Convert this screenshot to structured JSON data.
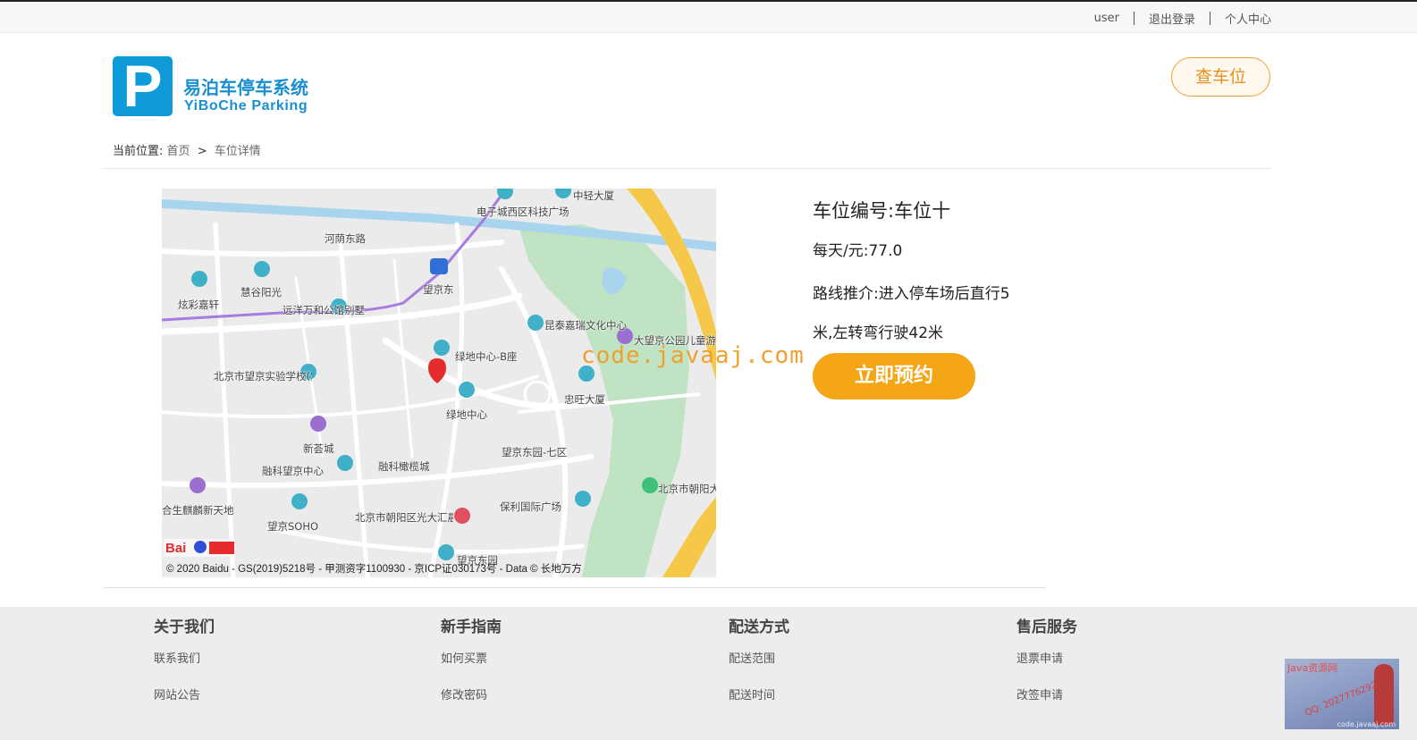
{
  "topbar": {
    "user": "user",
    "logout": "退出登录",
    "profile": "个人中心"
  },
  "logo": {
    "letter": "P",
    "name_cn": "易泊车停车系统",
    "name_en": "YiBoChe Parking"
  },
  "header": {
    "find_button": "查车位"
  },
  "breadcrumb": {
    "prefix": "当前位置:",
    "home": "首页",
    "separator": ">",
    "current": "车位详情"
  },
  "map": {
    "copyright": "© 2020 Baidu - GS(2019)5218号 - 甲测资字1100930 - 京ICP证030173号 - Data © 长地万方",
    "brand": "Bai 地图",
    "labels": [
      "电子城西区科技广场",
      "河荫东路",
      "慧谷阳光",
      "炫彩嘉轩",
      "远洋万和公馆别墅",
      "望京东",
      "昆泰嘉瑞文化中心",
      "大望京公园儿童游乐场",
      "绿地中心-B座",
      "北京市望京实验学校(宝星分校)",
      "绿地中心",
      "忠旺大厦",
      "新荟城",
      "融科橄榄城",
      "望京东园-七区",
      "融科望京中心",
      "北京市朝阳大望京公园",
      "合生麒麟新天地",
      "望京SOHO",
      "北京市朝阳区光大汇晨老年公寓",
      "保利国际广场",
      "望京东园",
      "中轻大厦"
    ]
  },
  "spot": {
    "number": "车位编号:车位十",
    "price": "每天/元:77.0",
    "route": "路线推介:进入停车场后直行5米,左转弯行驶42米",
    "reserve_button": "立即预约"
  },
  "watermark": "code.javaaj.com",
  "footer": {
    "columns": [
      {
        "title": "关于我们",
        "links": [
          "联系我们",
          "网站公告"
        ]
      },
      {
        "title": "新手指南",
        "links": [
          "如何买票",
          "修改密码"
        ]
      },
      {
        "title": "配送方式",
        "links": [
          "配送范围",
          "配送时间"
        ]
      },
      {
        "title": "售后服务",
        "links": [
          "退票申请",
          "改签申请"
        ]
      }
    ]
  },
  "corner_ad": {
    "title": "Java资源网",
    "qq": "QQ: 2027776292",
    "site": "code.javaaj.com"
  },
  "colors": {
    "brand_blue": "#1a8fcf",
    "accent_orange": "#f5a617",
    "map_park": "#bfe3c3",
    "map_river": "#a9d4ee"
  }
}
